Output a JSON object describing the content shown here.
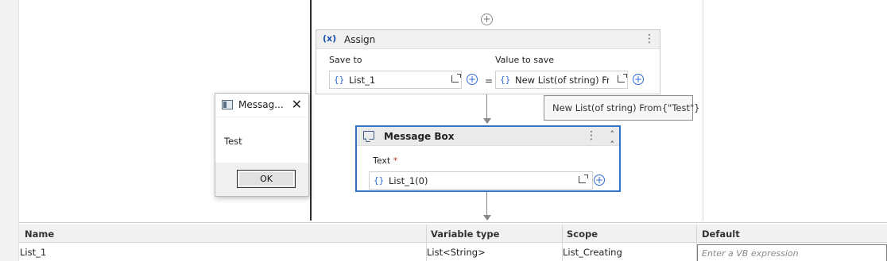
{
  "assign": {
    "icon_text": "(x)",
    "title": "Assign",
    "save_to_label": "Save to",
    "value_to_save_label": "Value to save",
    "save_to_value": "List_1",
    "value_to_save_value": "New List(of string) Fro",
    "equals": "=",
    "brace": "{}"
  },
  "tooltip": {
    "text": "New List(of string) From{\"Test\"}"
  },
  "message_box_activity": {
    "title": "Message Box",
    "text_label": "Text",
    "required_mark": "*",
    "text_value": "List_1(0)",
    "brace": "{}"
  },
  "dialog": {
    "title": "Messag...",
    "close_glyph": "✕",
    "body": "Test",
    "ok_label": "OK"
  },
  "variables": {
    "headers": {
      "name": "Name",
      "type": "Variable type",
      "scope": "Scope",
      "default": "Default"
    },
    "rows": [
      {
        "name": "List_1",
        "type": "List<String>",
        "scope": "List_Creating",
        "default_placeholder": "Enter a VB expression"
      }
    ]
  },
  "icons": {
    "plus": "⊕",
    "kebab": "⋮",
    "collapse": "⌃"
  },
  "colors": {
    "accent": "#2f73c9",
    "brace": "#2f6bd6",
    "required": "#c0392b"
  }
}
